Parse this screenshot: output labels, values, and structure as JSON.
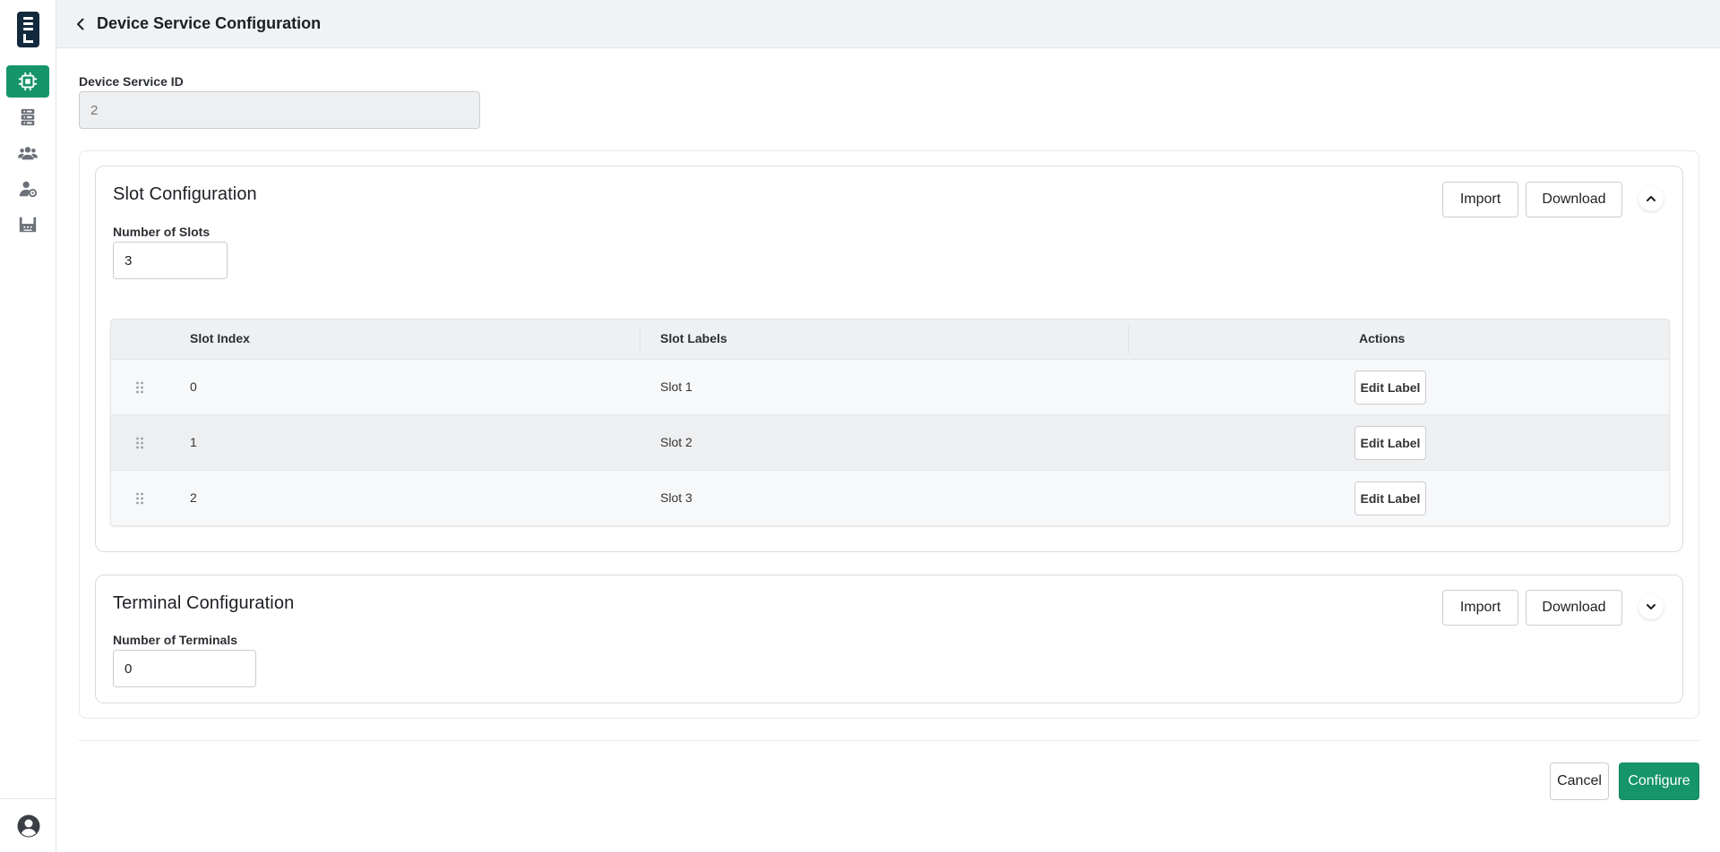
{
  "header": {
    "title": "Device Service Configuration",
    "back_icon": "chevron-left-icon"
  },
  "sidebar": {
    "logo_icon": "app-logo",
    "items": [
      {
        "icon": "chip-icon",
        "active": true
      },
      {
        "icon": "server-icon",
        "active": false
      },
      {
        "icon": "users-icon",
        "active": false
      },
      {
        "icon": "user-admin-icon",
        "active": false
      },
      {
        "icon": "factory-icon",
        "active": false
      }
    ],
    "profile_icon": "user-circle-icon"
  },
  "device_service": {
    "label": "Device Service ID",
    "value": "2"
  },
  "slot_config": {
    "title": "Slot Configuration",
    "import_label": "Import",
    "download_label": "Download",
    "collapse_icon": "chevron-up-icon",
    "number_label": "Number of Slots",
    "number_value": "3",
    "table": {
      "headers": [
        "Slot Index",
        "Slot Labels",
        "Actions"
      ],
      "rows": [
        {
          "index": "0",
          "label": "Slot 1",
          "action": "Edit Label"
        },
        {
          "index": "1",
          "label": "Slot 2",
          "action": "Edit Label"
        },
        {
          "index": "2",
          "label": "Slot 3",
          "action": "Edit Label"
        }
      ]
    }
  },
  "terminal_config": {
    "title": "Terminal Configuration",
    "import_label": "Import",
    "download_label": "Download",
    "expand_icon": "chevron-down-icon",
    "number_label": "Number of Terminals",
    "number_value": "0"
  },
  "footer": {
    "cancel_label": "Cancel",
    "configure_label": "Configure"
  },
  "colors": {
    "accent": "#16956a",
    "logo": "#13293d",
    "header_bg": "#f1f2f4"
  }
}
